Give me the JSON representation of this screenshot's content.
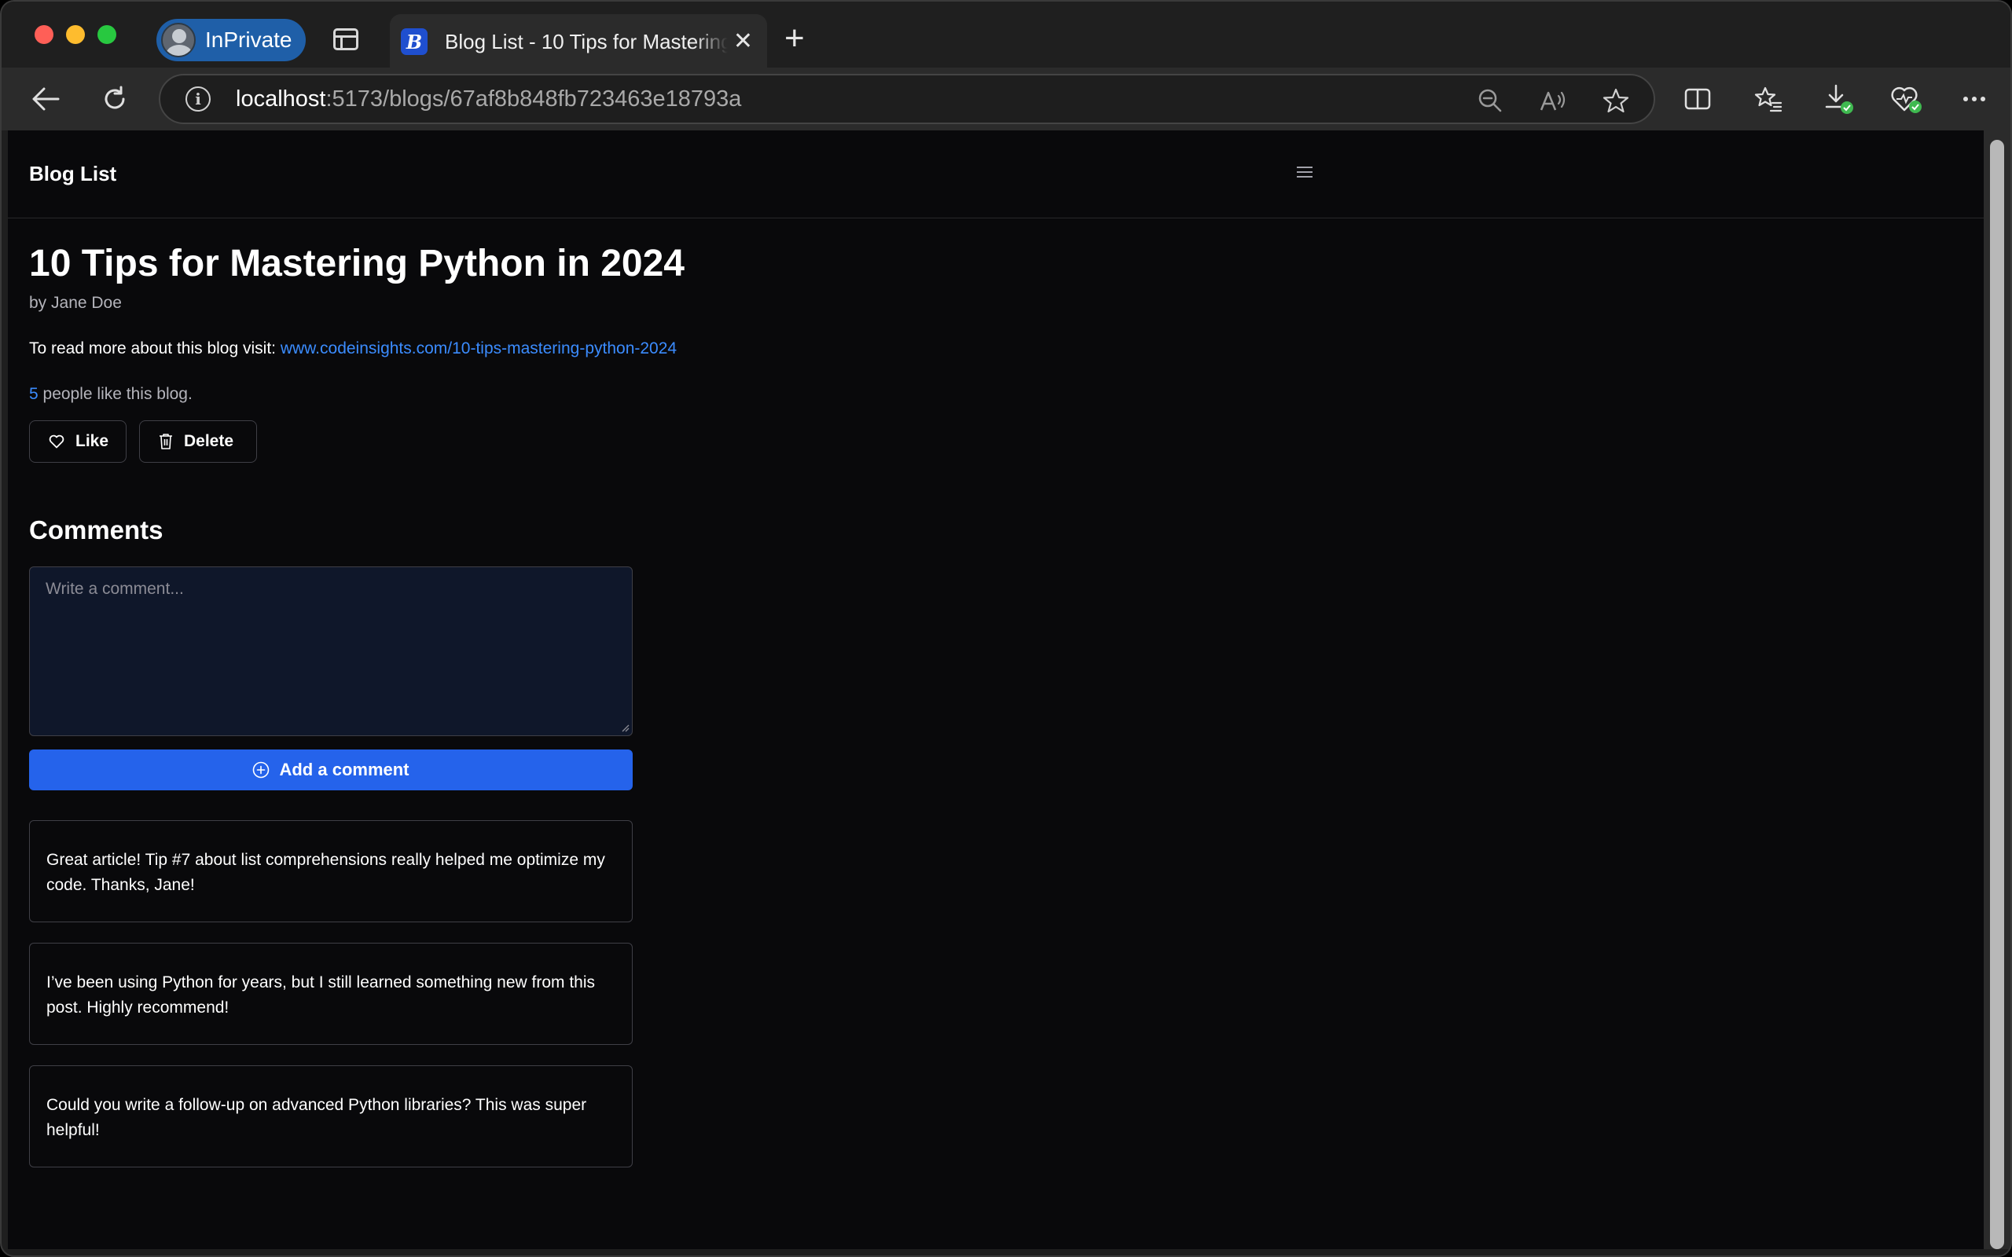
{
  "browser": {
    "profile_label": "InPrivate",
    "tab": {
      "favicon_letter": "B",
      "title": "Blog List - 10 Tips for Mastering Python in 2024"
    },
    "address": {
      "host": "localhost",
      "path": ":5173/blogs/67af8b848fb723463e18793a"
    },
    "icons": [
      "back-icon",
      "refresh-icon",
      "info-icon",
      "zoom-out-icon",
      "read-aloud-icon",
      "favorite-star-icon",
      "split-screen-icon",
      "favorites-icon",
      "downloads-icon",
      "browser-essentials-icon",
      "more-icon"
    ]
  },
  "site": {
    "brand": "Blog List"
  },
  "post": {
    "title": "10 Tips for Mastering Python in 2024",
    "byline": "by Jane Doe",
    "read_more_prefix": "To read more about this blog visit:",
    "read_more_link": "www.codeinsights.com/10-tips-mastering-python-2024",
    "likes_count": "5",
    "likes_suffix": " people like this blog.",
    "like_label": "Like",
    "delete_label": "Delete"
  },
  "comments": {
    "heading": "Comments",
    "placeholder": "Write a comment...",
    "add_label": "Add a comment",
    "items": [
      "Great article! Tip #7 about list comprehensions really helped me optimize my code. Thanks, Jane!",
      "I’ve been using Python for years, but I still learned something new from this post. Highly recommend!",
      "Could you write a follow-up on advanced Python libraries? This was super helpful!"
    ]
  },
  "colors": {
    "page_bg": "#09090b",
    "accent": "#2563eb",
    "link": "#3b8cff",
    "border": "#3f3f46"
  }
}
